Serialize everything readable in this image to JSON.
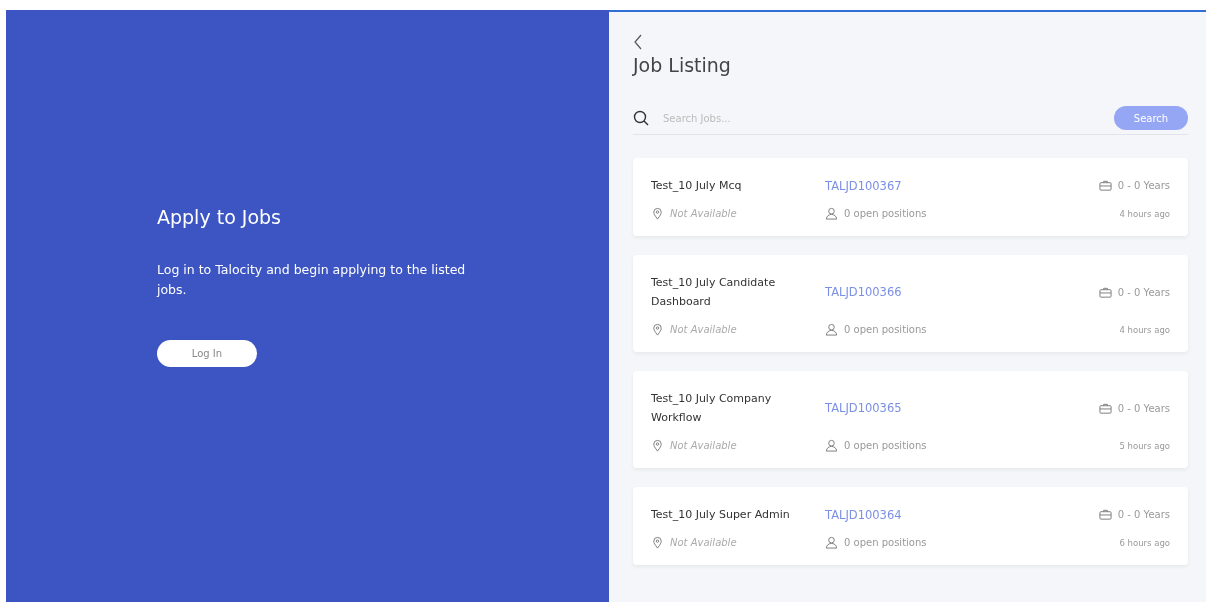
{
  "promo": {
    "title": "Apply to Jobs",
    "text": "Log in to Talocity and begin applying to the listed jobs.",
    "button": "Log In"
  },
  "listing": {
    "title": "Job Listing",
    "search": {
      "placeholder": "Search Jobs...",
      "button": "Search"
    },
    "jobs": [
      {
        "title": "Test_10 July Mcq",
        "id": "TALJD100367",
        "experience": "0 - 0 Years",
        "location": "Not Available",
        "positions": "0 open positions",
        "posted": "4 hours ago"
      },
      {
        "title": "Test_10 July Candidate Dashboard",
        "id": "TALJD100366",
        "experience": "0 - 0 Years",
        "location": "Not Available",
        "positions": "0 open positions",
        "posted": "4 hours ago"
      },
      {
        "title": "Test_10 July Company Workflow",
        "id": "TALJD100365",
        "experience": "0 - 0 Years",
        "location": "Not Available",
        "positions": "0 open positions",
        "posted": "5 hours ago"
      },
      {
        "title": "Test_10 July Super Admin",
        "id": "TALJD100364",
        "experience": "0 - 0 Years",
        "location": "Not Available",
        "positions": "0 open positions",
        "posted": "6 hours ago"
      }
    ]
  }
}
